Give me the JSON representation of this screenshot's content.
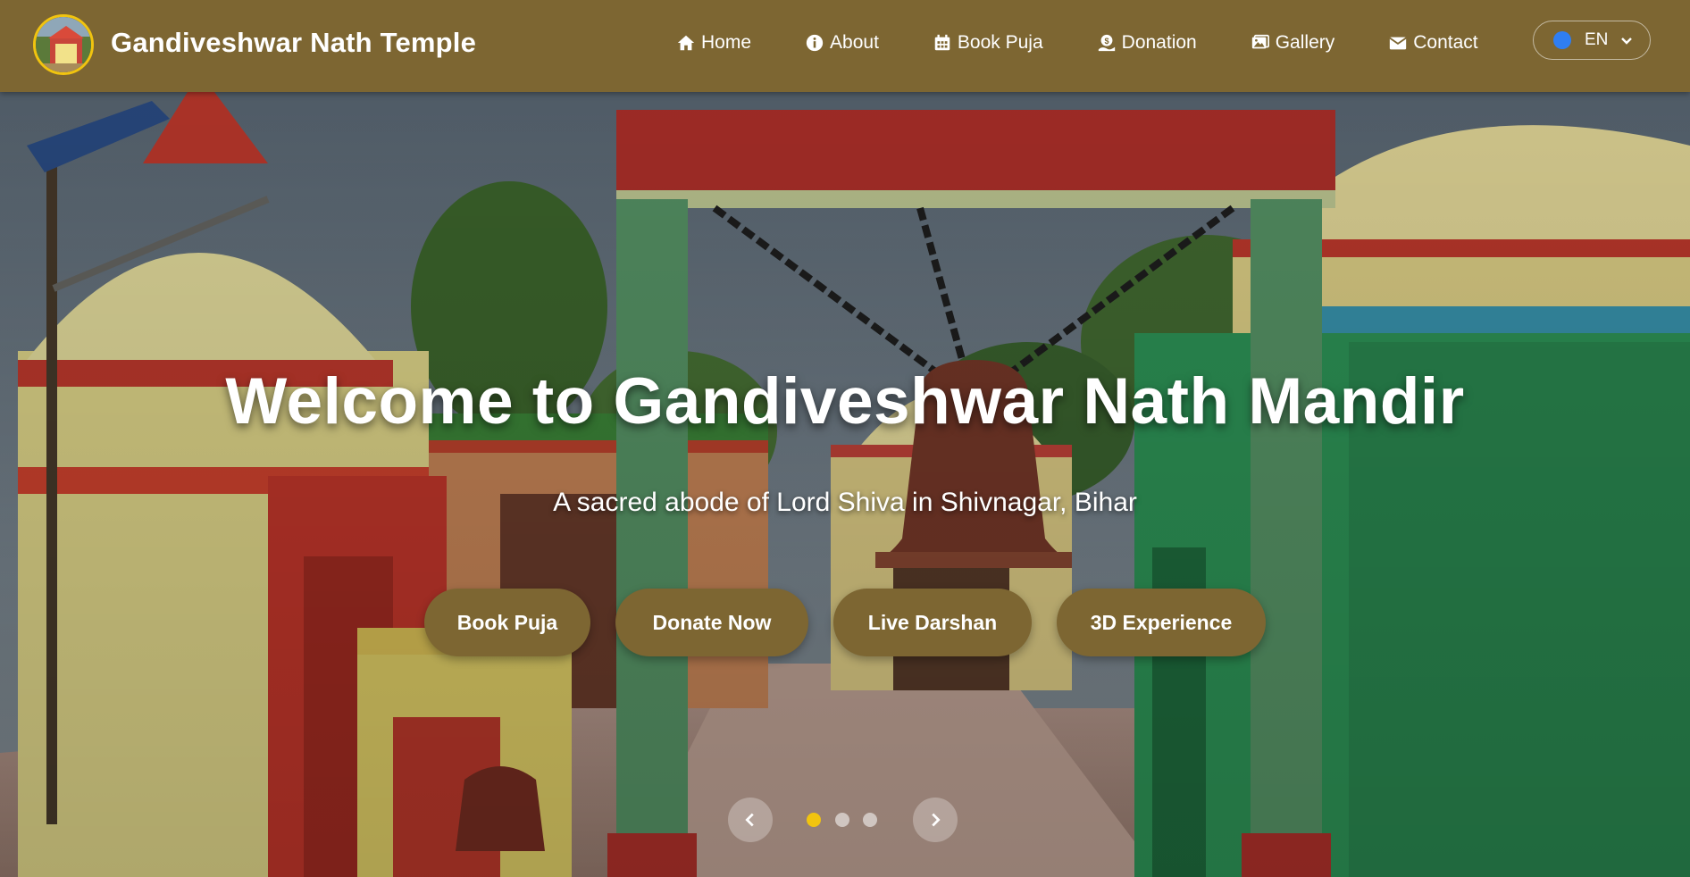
{
  "header": {
    "brand": "Gandiveshwar Nath Temple",
    "logo_icon": "temple-logo-icon",
    "nav": [
      {
        "label": "Home",
        "icon": "home-icon"
      },
      {
        "label": "About",
        "icon": "info-icon"
      },
      {
        "label": "Book Puja",
        "icon": "calendar-icon"
      },
      {
        "label": "Donation",
        "icon": "donation-icon"
      },
      {
        "label": "Gallery",
        "icon": "gallery-icon"
      },
      {
        "label": "Contact",
        "icon": "envelope-icon"
      }
    ],
    "language": {
      "value": "EN",
      "icon": "globe-icon"
    }
  },
  "hero": {
    "title": "Welcome to Gandiveshwar Nath Mandir",
    "subtitle": "A sacred abode of Lord Shiva in Shivnagar, Bihar",
    "buttons": [
      "Book Puja",
      "Donate Now",
      "Live Darshan",
      "3D Experience"
    ],
    "slides": {
      "count": 3,
      "active": 1
    }
  },
  "colors": {
    "navbar": "#7d6632",
    "button": "#7d6632",
    "active_dot": "#f1c40f",
    "text": "#ffffff"
  }
}
